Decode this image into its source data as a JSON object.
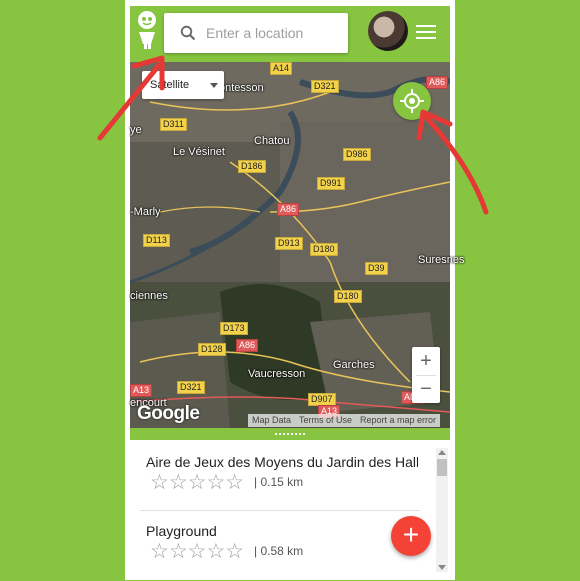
{
  "header": {
    "search_placeholder": "Enter a location",
    "logo_icon": "child-logo-icon",
    "search_icon": "search-icon",
    "avatar_icon": "user-avatar",
    "menu_icon": "hamburger-menu-icon"
  },
  "map": {
    "map_type": "Satellite",
    "zoom_in": "+",
    "zoom_out": "−",
    "google_logo": "Google",
    "attribution": [
      "Map Data",
      "Terms of Use",
      "Report a map error"
    ],
    "locate_icon": "crosshair-locate-icon",
    "towns": [
      "ontesson",
      "Chatou",
      "Le Vésinet",
      "-Marly",
      "Suresnes",
      "ciennes",
      "Vaucresson",
      "Garches",
      "encourt",
      "ye"
    ],
    "roads": [
      "A14",
      "D321",
      "A86",
      "D311",
      "D186",
      "D986",
      "D991",
      "A86",
      "D913",
      "D180",
      "D113",
      "D39",
      "D180",
      "D173",
      "D128",
      "A86",
      "D321",
      "A13",
      "D907",
      "A13",
      "A86"
    ]
  },
  "places": [
    {
      "name": "Aire de Jeux des Moyens du Jardin des Halles",
      "rating": "☆☆☆☆☆",
      "distance": "| 0.15 km"
    },
    {
      "name": "Playground",
      "rating": "☆☆☆☆☆",
      "distance": "| 0.58 km"
    }
  ],
  "fab": {
    "label": "+",
    "icon": "add-place-icon"
  },
  "colors": {
    "brand": "#87c540",
    "fab": "#f44336",
    "annotation_arrow": "#e53935"
  }
}
